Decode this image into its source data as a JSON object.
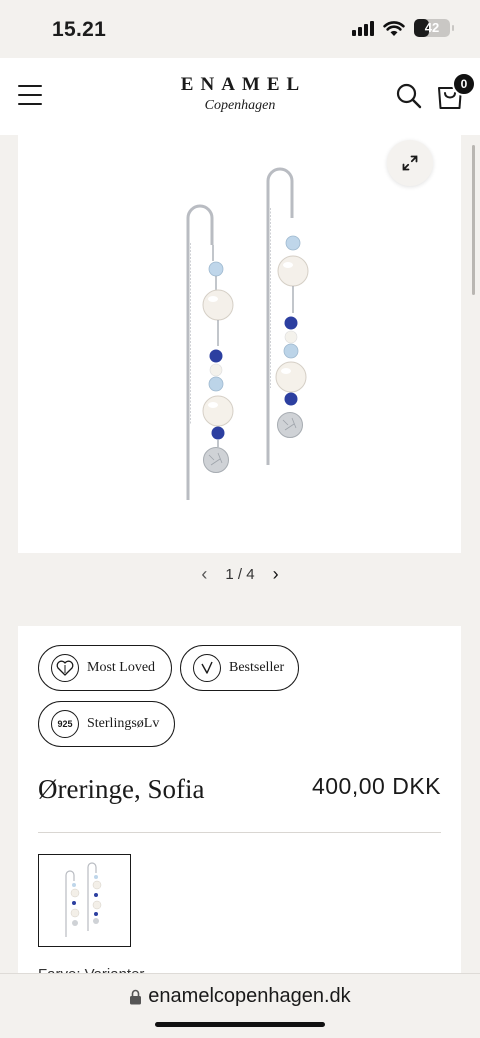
{
  "status": {
    "time": "15.21",
    "battery": "42",
    "battery_level": 0.42
  },
  "header": {
    "brand": "ENAMEL",
    "brand_sub": "Copenhagen",
    "cart_count": "0",
    "icons": [
      "menu-icon",
      "search-icon",
      "bag-icon"
    ]
  },
  "gallery": {
    "current": "1",
    "separator": "/",
    "total": "4",
    "prev": "‹",
    "next": "›"
  },
  "badges": {
    "most_loved": "Most Loved",
    "bestseller": "Bestseller",
    "silver": "SterlingsøLv",
    "silver_icon_text": "925"
  },
  "product": {
    "title": "Øreringe, Sofia",
    "price": "400,00 DKK",
    "partial_text": "Farve: Varianter"
  },
  "browser": {
    "url": "enamelcopenhagen.dk"
  },
  "colors": {
    "accent": "#1a1a1a",
    "page_bg": "#f3f1ee",
    "card_bg": "#ffffff"
  }
}
